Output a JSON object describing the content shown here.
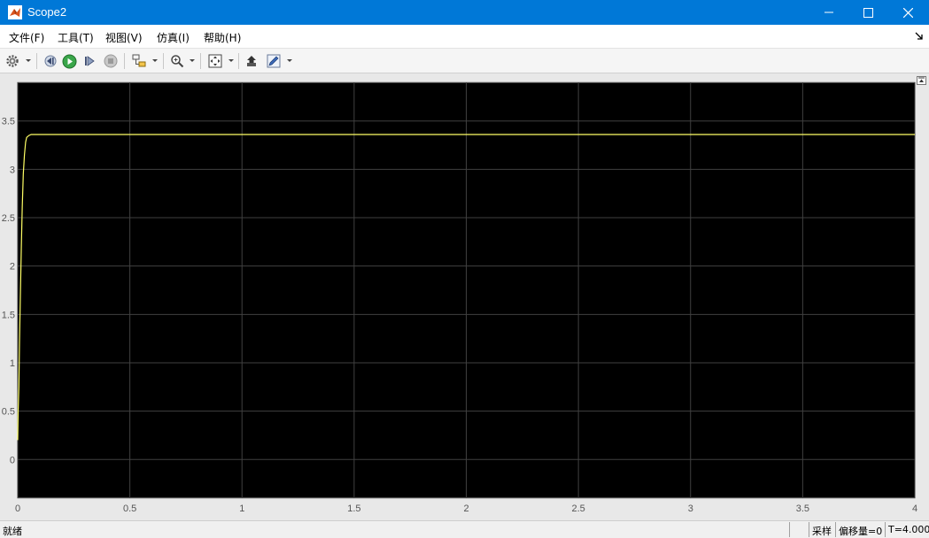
{
  "window": {
    "title": "Scope2",
    "minimize_label": "minimize",
    "maximize_label": "maximize",
    "close_label": "close"
  },
  "menu": {
    "items": [
      "文件(F)",
      "工具(T)",
      "视图(V)",
      "仿真(I)",
      "帮助(H)"
    ]
  },
  "toolbar": {
    "icons": [
      "gear-icon",
      "step-back-icon",
      "run-icon",
      "step-forward-icon",
      "stop-icon",
      "highlight-block-icon",
      "zoom-icon",
      "fit-to-view-icon",
      "restore-icon",
      "style-icon"
    ]
  },
  "status": {
    "text": "就绪",
    "mode": "采样",
    "offset": "偏移量=0",
    "time": "T=4.000"
  },
  "colors": {
    "plot_bg": "#000000",
    "grid": "#404040",
    "signal": "#ffff66",
    "titlebar": "#0078d7"
  },
  "chart_data": {
    "type": "line",
    "title": "",
    "xlabel": "",
    "ylabel": "",
    "xlim": [
      0,
      4
    ],
    "ylim": [
      -0.4,
      3.9
    ],
    "xticks": [
      "0",
      "0.5",
      "1",
      "1.5",
      "2",
      "2.5",
      "3",
      "3.5",
      "4"
    ],
    "yticks": [
      "0",
      "0.5",
      "1",
      "1.5",
      "2",
      "2.5",
      "3",
      "3.5"
    ],
    "grid": true,
    "series": [
      {
        "color": "#ffff66",
        "x": [
          0,
          0.002,
          0.005,
          0.008,
          0.012,
          0.016,
          0.02,
          0.025,
          0.03,
          0.035,
          0.04,
          0.05,
          0.06,
          0.08,
          0.1,
          0.5,
          1,
          1.5,
          2,
          2.5,
          3,
          3.5,
          4
        ],
        "y": [
          0.2,
          0.5,
          0.75,
          1.2,
          1.7,
          2.2,
          2.6,
          2.95,
          3.15,
          3.28,
          3.33,
          3.35,
          3.36,
          3.36,
          3.36,
          3.36,
          3.36,
          3.36,
          3.36,
          3.36,
          3.36,
          3.36,
          3.36
        ]
      }
    ]
  }
}
